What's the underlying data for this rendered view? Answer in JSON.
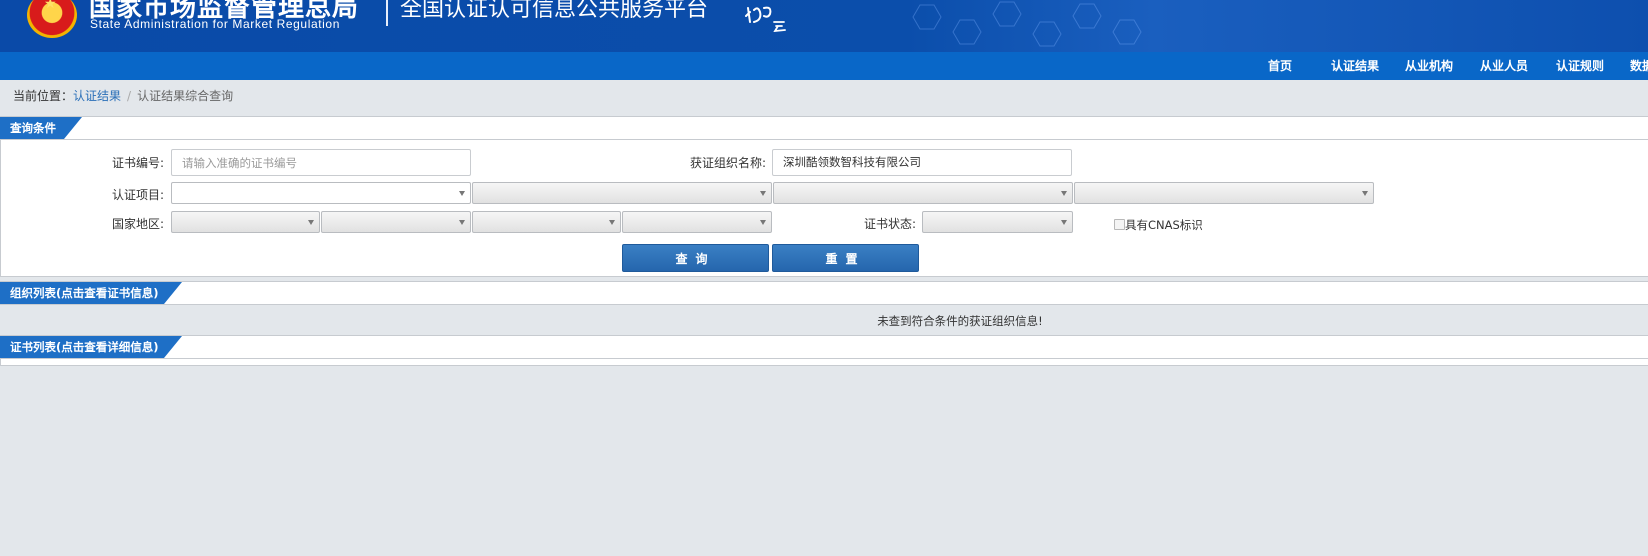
{
  "header": {
    "org_name_cn": "国家市场监督管理总局",
    "org_name_en": "State Administration  for  Market Regulation",
    "platform_title": "全国认证认可信息公共服务平台",
    "logo_text": "认证云",
    "bg_color": "#0b4eab"
  },
  "nav": {
    "items": [
      "首页",
      "认证结果",
      "从业机构",
      "从业人员",
      "认证规则",
      "数据"
    ],
    "bg_color": "#0967c8"
  },
  "breadcrumb": {
    "label": "当前位置：",
    "link": "认证结果",
    "separator": "/",
    "current": "认证结果综合查询"
  },
  "query_panel": {
    "title": "查询条件",
    "cert_number_label": "证书编号:",
    "cert_number_value": "",
    "cert_number_placeholder": "请输入准确的证书编号",
    "org_name_label": "获证组织名称:",
    "org_name_value": "深圳酷领数智科技有限公司",
    "cert_item_label": "认证项目:",
    "region_label": "国家地区:",
    "status_label": "证书状态:",
    "cnas_label": "具有CNAS标识",
    "cnas_checked": false,
    "query_button": "查询",
    "reset_button": "重置",
    "accent_color": "#1e6fc6"
  },
  "org_list": {
    "title": "组织列表(点击查看证书信息)",
    "empty_message": "未查到符合条件的获证组织信息!"
  },
  "cert_list": {
    "title": "证书列表(点击查看详细信息)"
  }
}
